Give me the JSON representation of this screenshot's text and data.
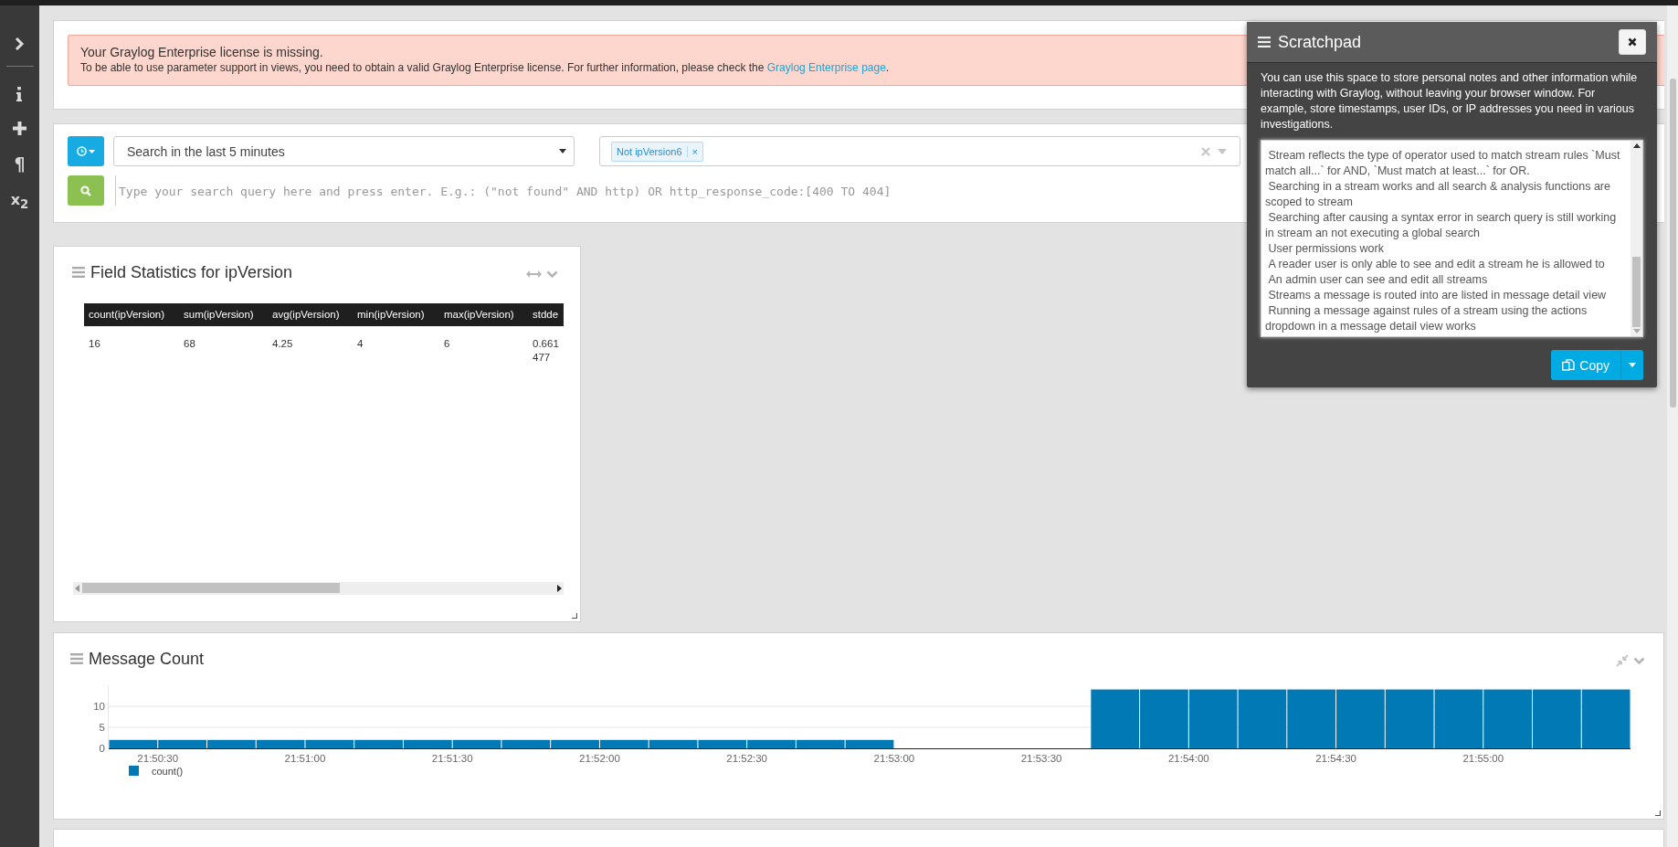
{
  "sidebar": {
    "symbols": [
      "¶",
      "x$_{2}$"
    ]
  },
  "alert": {
    "title": "Your Graylog Enterprise license is missing.",
    "text": "To be able to use parameter support in views, you need to obtain a valid Graylog Enterprise license. For further information, please check the ",
    "link": "Graylog Enterprise page",
    "after": "."
  },
  "search": {
    "timerange": "Search in the last 5 minutes",
    "filters": [
      {
        "label": "Not ipVersion6",
        "remove": "×"
      }
    ],
    "query_placeholder": "Type your search query here and press enter. E.g.: (\"not found\" AND http) OR http_response_code:[400 TO 404]"
  },
  "field_statistics": {
    "title": "Field Statistics for ipVersion",
    "columns": [
      "count(ipVersion)",
      "sum(ipVersion)",
      "avg(ipVersion)",
      "min(ipVersion)",
      "max(ipVersion)",
      "stdde"
    ],
    "rows": [
      [
        "16",
        "68",
        "4.25",
        "4",
        "6",
        "0.661477"
      ]
    ]
  },
  "message_count": {
    "title": "Message Count",
    "chart_data": {
      "type": "bar",
      "categories": [
        null,
        "21:50:30",
        null,
        null,
        "21:51:00",
        null,
        null,
        "21:51:30",
        null,
        null,
        "21:52:00",
        null,
        null,
        "21:52:30",
        null,
        null,
        "21:53:00",
        null,
        null,
        "21:53:30",
        null,
        null,
        "21:54:00",
        null,
        null,
        "21:54:30",
        null,
        null,
        "21:55:00",
        null,
        null
      ],
      "series": [
        {
          "name": "count()",
          "color": "#0079b5",
          "values": [
            2,
            2,
            2,
            2,
            2,
            2,
            2,
            2,
            2,
            2,
            2,
            2,
            2,
            2,
            2,
            2,
            null,
            null,
            null,
            null,
            14,
            14,
            14,
            14,
            14,
            14,
            14,
            14,
            14,
            14,
            14
          ]
        }
      ],
      "ylim": [
        0,
        15
      ],
      "yticks": [
        0,
        5,
        10
      ]
    }
  },
  "scratchpad": {
    "title": "Scratchpad",
    "description": "You can use this space to store personal notes and other information while interacting with Graylog, without leaving your browser window. For example, store timestamps, user IDs, or IP addresses you need in various investigations.",
    "notes": [
      " Stream reflects the type of operator used to match stream rules `Must match all...` for AND, `Must match at least...` for OR.",
      " Searching in a stream works and all search & analysis functions are scoped to stream",
      " Searching after causing a syntax error in search query is still working in stream an not executing a global search",
      " User permissions work",
      " A reader user is only able to see and edit a stream he is allowed to",
      " An admin user can see and edit all streams",
      " Streams a message is routed into are listed in message detail view",
      " Running a message against rules of a stream using the actions dropdown in a message detail view works"
    ],
    "copy": "Copy"
  }
}
